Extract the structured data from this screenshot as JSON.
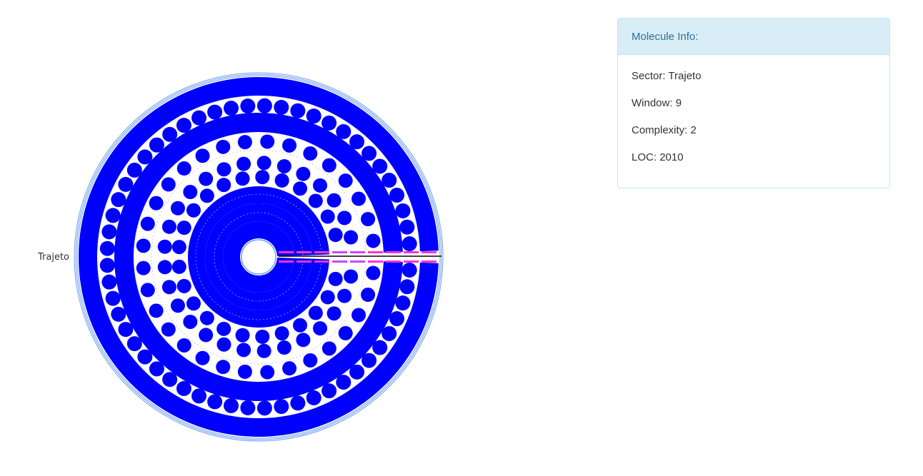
{
  "diagram": {
    "sector_label": "Trajeto"
  },
  "info_panel": {
    "heading": "Molecule Info:",
    "rows": [
      {
        "label": "Sector: ",
        "value": "Trajeto"
      },
      {
        "label": "Window: ",
        "value": "9"
      },
      {
        "label": "Complexity: ",
        "value": "2"
      },
      {
        "label": "LOC: ",
        "value": "2010"
      }
    ]
  },
  "colors": {
    "molecule_fill": "#0000ff",
    "outer_ring_stroke": "#6f9ff0",
    "panel_heading_bg": "#d9edf7",
    "panel_heading_text": "#31708f",
    "panel_border": "#bce8f1",
    "window_pink": "#ff33cc",
    "window_purple": "#cc44ff",
    "window_line": "#000000"
  }
}
